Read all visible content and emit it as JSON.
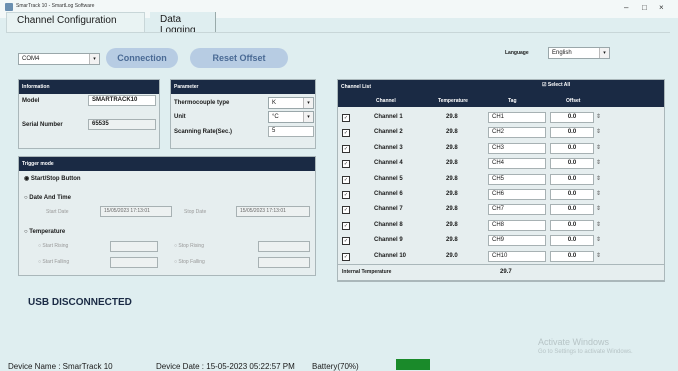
{
  "window": {
    "title": "SmarTrack 10 - SmartLog Software",
    "minimize": "–",
    "maximize": "□",
    "close": "×"
  },
  "tabs": [
    {
      "label": "Channel Configuration"
    },
    {
      "label": "Data Logging"
    }
  ],
  "toolbar": {
    "port": "COM4",
    "connection_label": "Connection",
    "reset_offset_label": "Reset Offset",
    "language_label": "Language",
    "language_value": "English"
  },
  "information": {
    "title": "Information",
    "model_label": "Model",
    "model_value": "SMARTRACK10",
    "serial_label": "Serial Number",
    "serial_value": "65535"
  },
  "parameter": {
    "title": "Parameter",
    "tc_label": "Thermocouple type",
    "tc_value": "K",
    "unit_label": "Unit",
    "unit_value": "°C",
    "rate_label": "Scanning Rate(Sec.)",
    "rate_value": "5"
  },
  "trigger": {
    "title": "Trigger mode",
    "start_stop": "Start/Stop Button",
    "date_time": "Date And Time",
    "start_date_label": "Start Date",
    "start_date_value": "15/05/2023 17:13:01",
    "stop_date_label": "Stop Date",
    "stop_date_value": "15/05/2023 17:13:01",
    "temperature": "Temperature",
    "start_rising": "Start Rising",
    "stop_rising": "Stop Rising",
    "start_falling": "Start Falling",
    "stop_falling": "Stop Falling"
  },
  "channel_list": {
    "title": "Channel List",
    "select_all": "Select All",
    "columns": [
      "Channel",
      "Temperature",
      "Tag",
      "Offset"
    ],
    "rows": [
      {
        "channel": "Channel 1",
        "temp": "29.8",
        "tag": "CH1",
        "offset": "0.0"
      },
      {
        "channel": "Channel 2",
        "temp": "29.8",
        "tag": "CH2",
        "offset": "0.0"
      },
      {
        "channel": "Channel 3",
        "temp": "29.8",
        "tag": "CH3",
        "offset": "0.0"
      },
      {
        "channel": "Channel 4",
        "temp": "29.8",
        "tag": "CH4",
        "offset": "0.0"
      },
      {
        "channel": "Channel 5",
        "temp": "29.8",
        "tag": "CH5",
        "offset": "0.0"
      },
      {
        "channel": "Channel 6",
        "temp": "29.8",
        "tag": "CH6",
        "offset": "0.0"
      },
      {
        "channel": "Channel 7",
        "temp": "29.8",
        "tag": "CH7",
        "offset": "0.0"
      },
      {
        "channel": "Channel 8",
        "temp": "29.8",
        "tag": "CH8",
        "offset": "0.0"
      },
      {
        "channel": "Channel 9",
        "temp": "29.8",
        "tag": "CH9",
        "offset": "0.0"
      },
      {
        "channel": "Channel 10",
        "temp": "29.0",
        "tag": "CH10",
        "offset": "0.0"
      }
    ],
    "internal_label": "Internal Temperature",
    "internal_value": "29.7"
  },
  "usb_status": "USB DISCONNECTED",
  "watermark": {
    "line1": "Activate Windows",
    "line2": "Go to Settings to activate Windows."
  },
  "status": {
    "device_name": "Device Name : SmarTrack 10",
    "device_date": "Device Date : 15-05-2023 05:22:57 PM",
    "battery": "Battery(70%)"
  },
  "colors": {
    "header": "#1a2a44",
    "background": "#dfeef0",
    "battery": "#1a8a2a"
  }
}
